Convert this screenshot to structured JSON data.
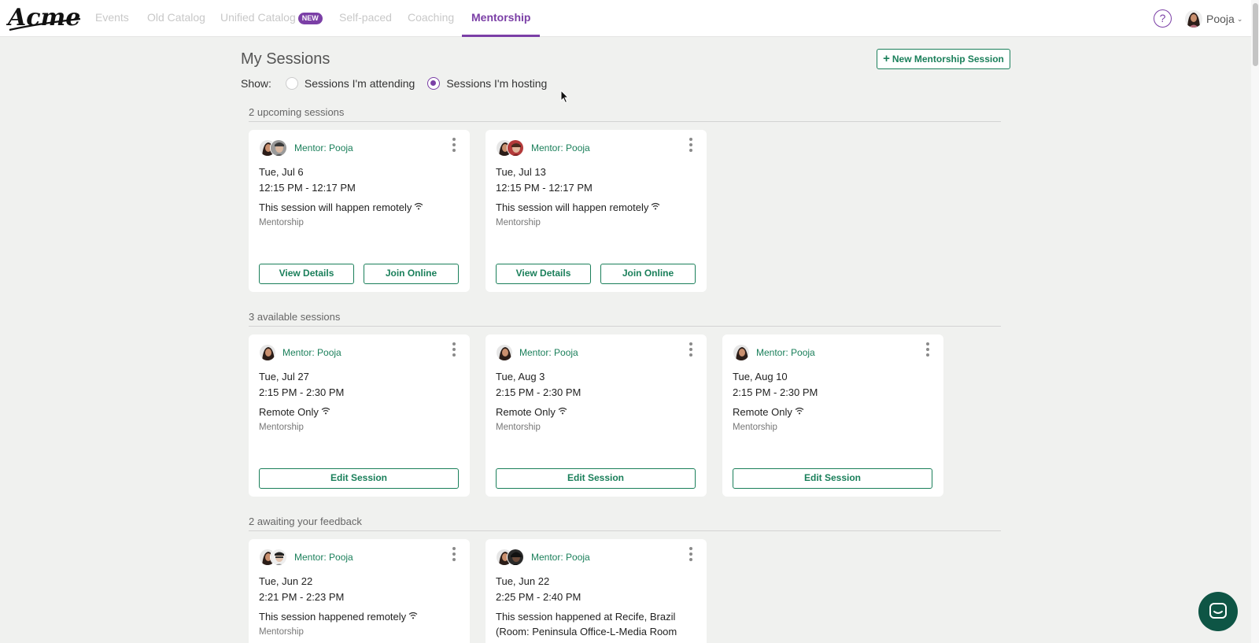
{
  "nav": {
    "logo_text": "Acme",
    "tabs": [
      {
        "label": "Events"
      },
      {
        "label": "Old Catalog"
      },
      {
        "label": "Unified Catalog",
        "badge": "NEW"
      },
      {
        "label": "Self-paced"
      },
      {
        "label": "Coaching"
      },
      {
        "label": "Mentorship",
        "active": true
      }
    ],
    "help_label": "?",
    "user_name": "Pooja"
  },
  "header": {
    "title": "My Sessions",
    "show_label": "Show:",
    "options": [
      {
        "label": "Sessions I'm attending",
        "selected": false
      },
      {
        "label": "Sessions I'm hosting",
        "selected": true
      }
    ],
    "new_button": "New Mentorship Session"
  },
  "sections": [
    {
      "heading": "2 upcoming sessions",
      "cards": [
        {
          "mentor": "Mentor: Pooja",
          "date": "Tue, Jul 6",
          "time": "12:15 PM - 12:17 PM",
          "location": "This session will happen remotely",
          "category": "Mentorship",
          "buttons": [
            "View Details",
            "Join Online"
          ]
        },
        {
          "mentor": "Mentor: Pooja",
          "date": "Tue, Jul 13",
          "time": "12:15 PM - 12:17 PM",
          "location": "This session will happen remotely",
          "category": "Mentorship",
          "buttons": [
            "View Details",
            "Join Online"
          ]
        }
      ]
    },
    {
      "heading": "3 available sessions",
      "cards": [
        {
          "mentor": "Mentor: Pooja",
          "date": "Tue, Jul 27",
          "time": "2:15 PM - 2:30 PM",
          "location": "Remote Only",
          "category": "Mentorship",
          "buttons": [
            "Edit Session"
          ]
        },
        {
          "mentor": "Mentor: Pooja",
          "date": "Tue, Aug 3",
          "time": "2:15 PM - 2:30 PM",
          "location": "Remote Only",
          "category": "Mentorship",
          "buttons": [
            "Edit Session"
          ]
        },
        {
          "mentor": "Mentor: Pooja",
          "date": "Tue, Aug 10",
          "time": "2:15 PM - 2:30 PM",
          "location": "Remote Only",
          "category": "Mentorship",
          "buttons": [
            "Edit Session"
          ]
        }
      ]
    },
    {
      "heading": "2 awaiting your feedback",
      "cards": [
        {
          "mentor": "Mentor: Pooja",
          "date": "Tue, Jun 22",
          "time": "2:21 PM - 2:23 PM",
          "location": "This session happened remotely",
          "category": "Mentorship"
        },
        {
          "mentor": "Mentor: Pooja",
          "date": "Tue, Jun 22",
          "time": "2:25 PM - 2:40 PM",
          "location": "This session happened at Recife, Brazil (Room: Peninsula Office-L-Media Room"
        }
      ]
    }
  ],
  "icons": {
    "wifi": "wifi-icon",
    "kebab": "more-vertical-icon",
    "chat": "chat-bubble-icon",
    "plus": "plus-icon"
  },
  "colors": {
    "accent_purple": "#7b3fa6",
    "accent_green": "#1a7f5a",
    "chat_bg": "#0e5545",
    "page_bg": "#f0f1ef"
  }
}
